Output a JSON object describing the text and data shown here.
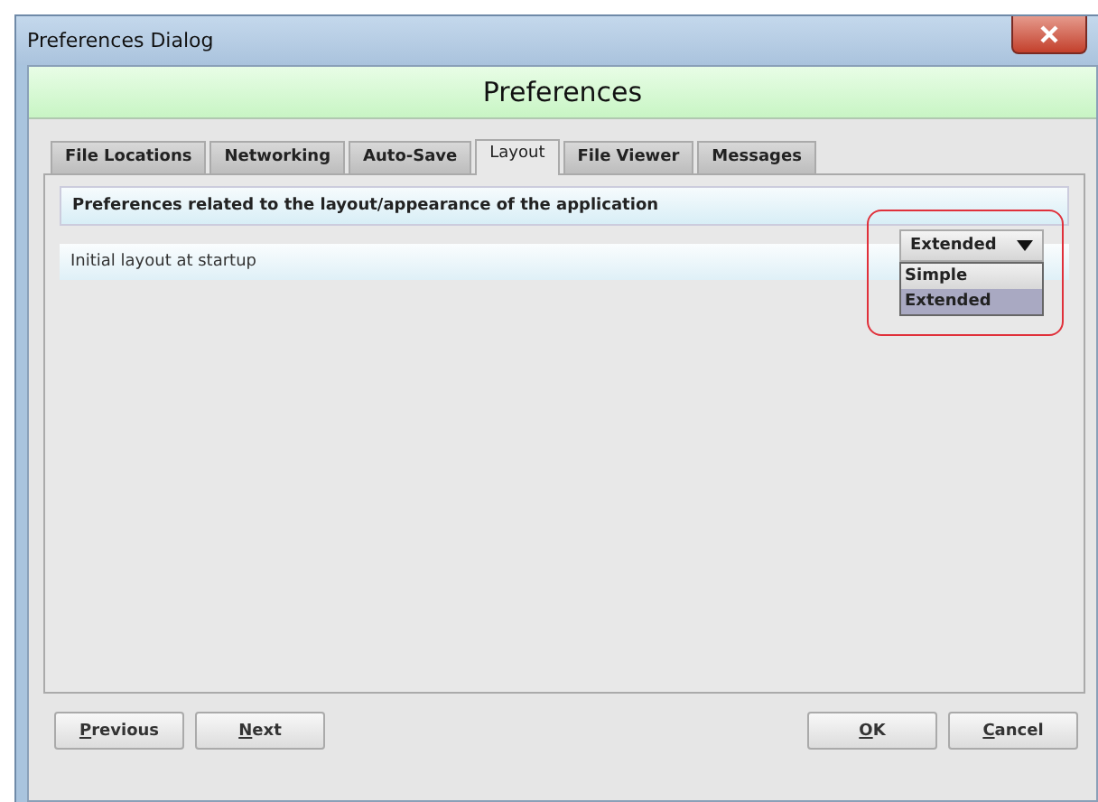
{
  "window": {
    "title": "Preferences Dialog"
  },
  "header": "Preferences",
  "tabs": [
    {
      "label": "File Locations",
      "selected": false
    },
    {
      "label": "Networking",
      "selected": false
    },
    {
      "label": "Auto-Save",
      "selected": false
    },
    {
      "label": "Layout",
      "selected": true
    },
    {
      "label": "File Viewer",
      "selected": false
    },
    {
      "label": "Messages",
      "selected": false
    }
  ],
  "section_title": "Preferences related to the layout/appearance of the application",
  "setting": {
    "label": "Initial layout at startup",
    "dropdown": {
      "value": "Extended",
      "expanded": true,
      "highlighted": true,
      "options": [
        {
          "label": "Simple",
          "selected": false
        },
        {
          "label": "Extended",
          "selected": true
        }
      ]
    }
  },
  "buttons": {
    "left": [
      "Previous",
      "Next"
    ],
    "right": [
      "OK",
      "Cancel"
    ]
  }
}
